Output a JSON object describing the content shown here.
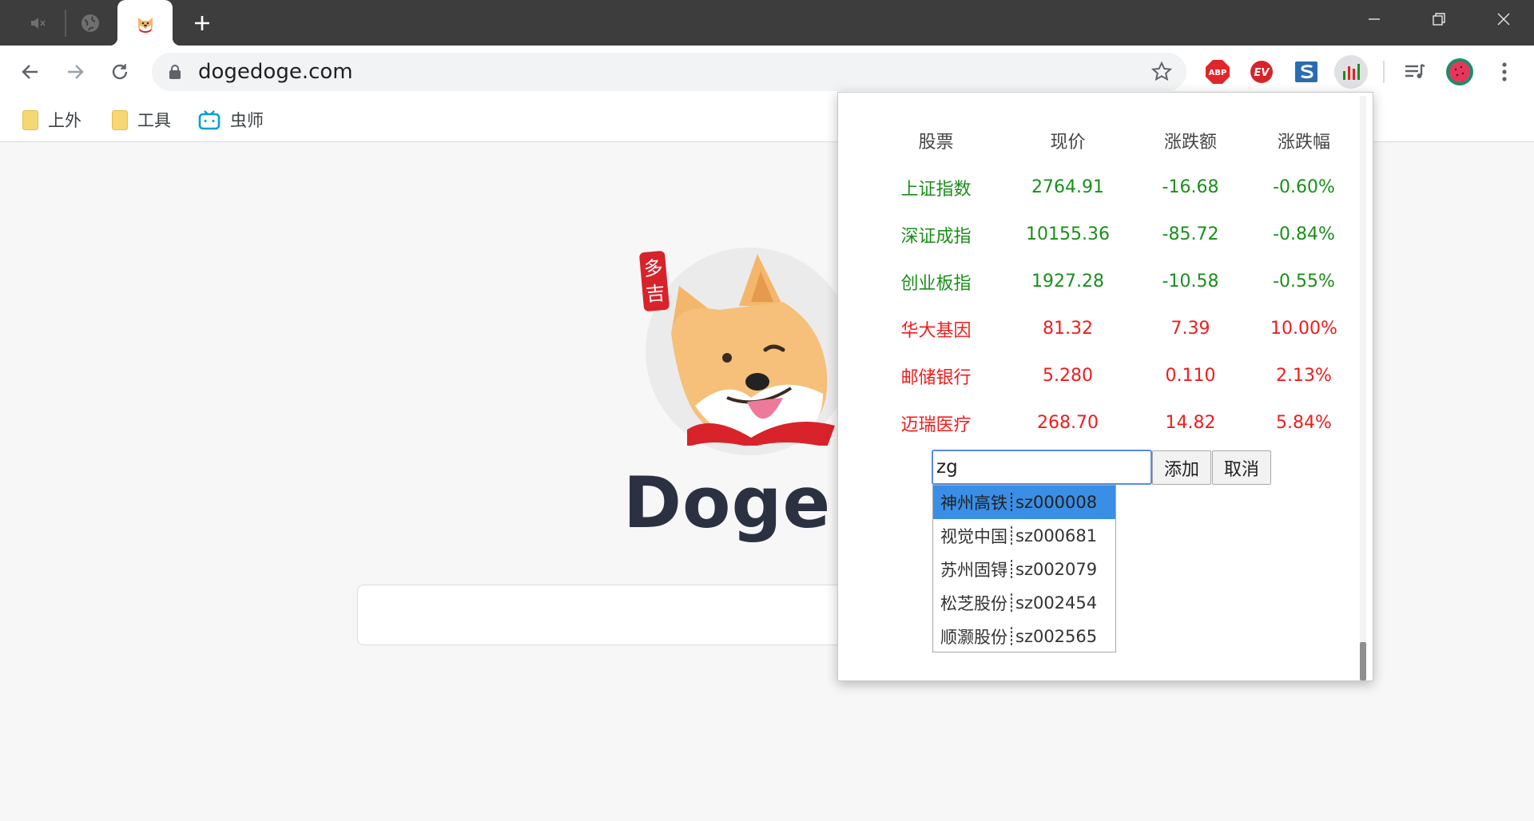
{
  "browser": {
    "url": "dogedoge.com",
    "new_tab_symbol": "+"
  },
  "bookmarks": [
    {
      "label": "上外",
      "icon": "folder-icon"
    },
    {
      "label": "工具",
      "icon": "folder-icon"
    },
    {
      "label": "虫师",
      "icon": "bilibili-icon"
    }
  ],
  "extensions": {
    "abp_label": "ABP",
    "ev_label": "EV"
  },
  "page": {
    "brand_text": "DogeDo",
    "seal_text": "多吉"
  },
  "popup": {
    "headers": [
      "股票",
      "现价",
      "涨跌额",
      "涨跌幅"
    ],
    "rows": [
      {
        "name": "上证指数",
        "price": "2764.91",
        "change": "-16.68",
        "pct": "-0.60%",
        "trend": "down"
      },
      {
        "name": "深证成指",
        "price": "10155.36",
        "change": "-85.72",
        "pct": "-0.84%",
        "trend": "down"
      },
      {
        "name": "创业板指",
        "price": "1927.28",
        "change": "-10.58",
        "pct": "-0.55%",
        "trend": "down"
      },
      {
        "name": "华大基因",
        "price": "81.32",
        "change": "7.39",
        "pct": "10.00%",
        "trend": "up"
      },
      {
        "name": "邮储银行",
        "price": "5.280",
        "change": "0.110",
        "pct": "2.13%",
        "trend": "up"
      },
      {
        "name": "迈瑞医疗",
        "price": "268.70",
        "change": "14.82",
        "pct": "5.84%",
        "trend": "up"
      }
    ],
    "input_value": "zg",
    "add_label": "添加",
    "cancel_label": "取消",
    "suggestions": [
      {
        "name": "神州高铁",
        "code": "sz000008",
        "active": true
      },
      {
        "name": "视觉中国",
        "code": "sz000681",
        "active": false
      },
      {
        "name": "苏州固锝",
        "code": "sz002079",
        "active": false
      },
      {
        "name": "松芝股份",
        "code": "sz002454",
        "active": false
      },
      {
        "name": "顺灏股份",
        "code": "sz002565",
        "active": false
      }
    ],
    "colors": {
      "down": "#1a8f1a",
      "up": "#f01c1c",
      "highlight": "#3a8ee6"
    }
  }
}
